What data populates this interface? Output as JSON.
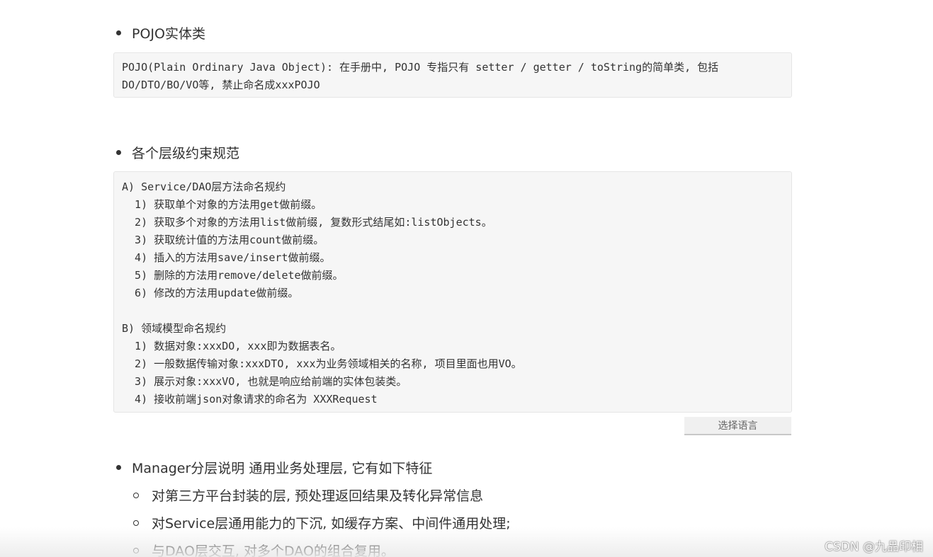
{
  "sections": {
    "pojo": {
      "heading": "POJO实体类",
      "code_lines": [
        "POJO(Plain Ordinary Java Object): 在手册中, POJO 专指只有 setter / getter / toString的简单类, 包括",
        "DO/DTO/BO/VO等, 禁止命名成xxxPOJO"
      ]
    },
    "layers": {
      "heading": "各个层级约束规范",
      "code_lines": [
        "A) Service/DAO层方法命名规约",
        "  1) 获取单个对象的方法用get做前缀。",
        "  2) 获取多个对象的方法用list做前缀, 复数形式结尾如:listObjects。",
        "  3) 获取统计值的方法用count做前缀。",
        "  4) 插入的方法用save/insert做前缀。",
        "  5) 删除的方法用remove/delete做前缀。",
        "  6) 修改的方法用update做前缀。",
        "",
        "B) 领域模型命名规约",
        "  1) 数据对象:xxxDO, xxx即为数据表名。",
        "  2) 一般数据传输对象:xxxDTO, xxx为业务领域相关的名称, 项目里面也用VO。",
        "  3) 展示对象:xxxVO, 也就是响应给前端的实体包装类。",
        "  4) 接收前端json对象请求的命名为 XXXRequest"
      ],
      "lang_select_label": "选择语言"
    },
    "manager": {
      "heading": "Manager分层说明 通用业务处理层, 它有如下特征",
      "items": [
        "对第三方平台封装的层, 预处理返回结果及转化异常信息",
        "对Service层通用能力的下沉, 如缓存方案、中间件通用处理;",
        "与DAO层交互, 对多个DAO的组合复用。"
      ]
    }
  },
  "watermark": "CSDN @九品印相"
}
